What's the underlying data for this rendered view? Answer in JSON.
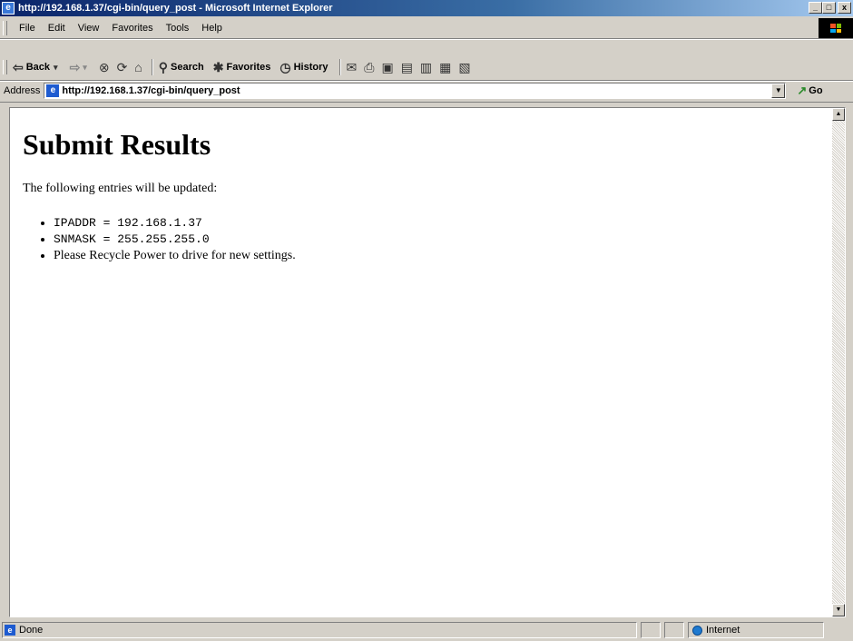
{
  "window": {
    "title": "http://192.168.1.37/cgi-bin/query_post - Microsoft Internet Explorer",
    "buttons": [
      "_",
      "□",
      "x"
    ]
  },
  "menu": [
    "File",
    "Edit",
    "View",
    "Favorites",
    "Tools",
    "Help"
  ],
  "toolbar": {
    "back": "Back",
    "search": "Search",
    "favorites": "Favorites",
    "history": "History"
  },
  "address": {
    "label": "Address",
    "url": "http://192.168.1.37/cgi-bin/query_post",
    "go": "Go"
  },
  "page": {
    "heading": "Submit Results",
    "intro": "The following entries will be updated:",
    "items": [
      "IPADDR = 192.168.1.37",
      "SNMASK = 255.255.255.0",
      "Please Recycle Power to drive for new settings."
    ]
  },
  "status": {
    "text": "Done",
    "zone": "Internet"
  }
}
